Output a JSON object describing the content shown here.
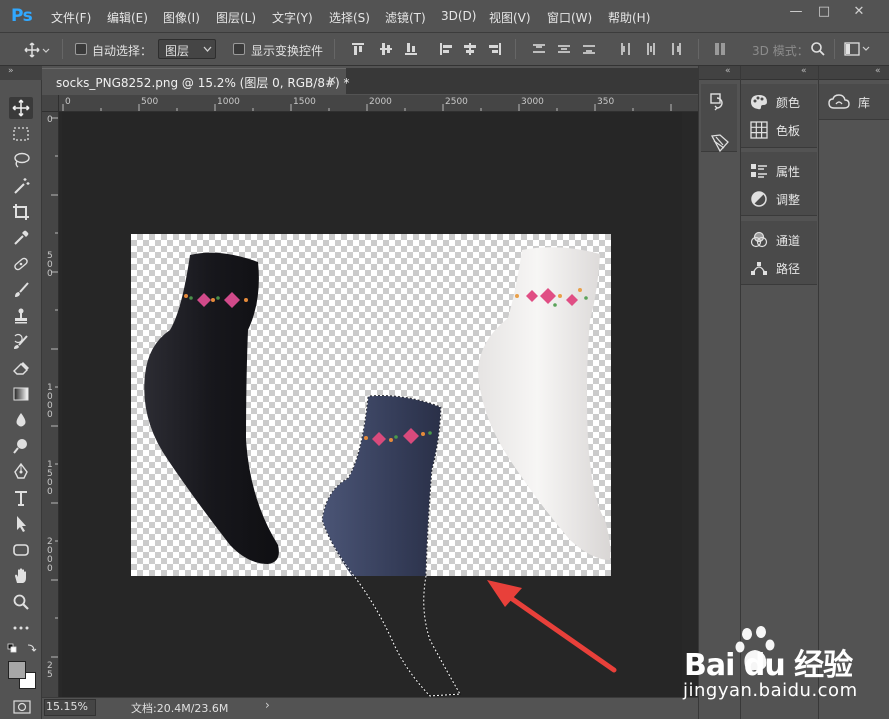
{
  "app": {
    "logo": "Ps"
  },
  "menu": [
    "文件(F)",
    "编辑(E)",
    "图像(I)",
    "图层(L)",
    "文字(Y)",
    "选择(S)",
    "滤镜(T)",
    "3D(D)",
    "视图(V)",
    "窗口(W)",
    "帮助(H)"
  ],
  "window_controls": {
    "minimize": "—",
    "restore": "□",
    "close": "✕"
  },
  "options_bar": {
    "auto_select_label": "自动选择：",
    "auto_select_checked": false,
    "layer_dropdown_value": "图层",
    "show_transform_label": "显示变换控件",
    "show_transform_checked": false,
    "mode_3d_label": "3D 模式："
  },
  "document_tab": {
    "title": "socks_PNG8252.png @ 15.2% (图层 0, RGB/8#) *",
    "close": "×"
  },
  "ruler_top": {
    "ticks": [
      "0",
      "500",
      "1000",
      "1500",
      "2000",
      "2500",
      "3000",
      "350"
    ]
  },
  "ruler_left": {
    "ticks": [
      "0",
      "5\n0\n0",
      "1\n0\n0\n0",
      "1\n5\n0\n0",
      "2\n0\n0\n0",
      "2\n5"
    ]
  },
  "status_bar": {
    "zoom": "15.15%",
    "doc_size": "文档:20.4M/23.6M",
    "arrow": "›"
  },
  "panels": {
    "group1": [
      {
        "icon": "palette-icon",
        "label": "颜色"
      },
      {
        "icon": "grid-icon",
        "label": "色板"
      }
    ],
    "group2": [
      {
        "icon": "properties-icon",
        "label": "属性"
      },
      {
        "icon": "adjustment-icon",
        "label": "调整"
      }
    ],
    "group3": [
      {
        "icon": "channels-icon",
        "label": "通道"
      },
      {
        "icon": "paths-icon",
        "label": "路径"
      }
    ],
    "library": {
      "icon": "cc-library-icon",
      "label": "库"
    }
  },
  "watermark": {
    "brand": "Bai du 经验",
    "url": "jingyan.baidu.com"
  },
  "colors": {
    "ui_bg": "#535353",
    "canvas_bg": "#282828",
    "accent": "#31a8ff",
    "annotation_arrow": "#e8403a"
  }
}
